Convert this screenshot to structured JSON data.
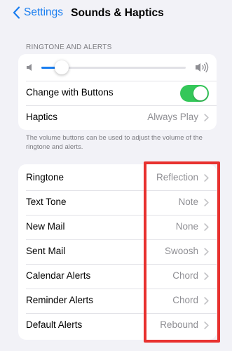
{
  "nav": {
    "back_label": "Settings",
    "title": "Sounds & Haptics"
  },
  "ringtone_alerts": {
    "header": "RINGTONE AND ALERTS",
    "volume_level_percent": 10,
    "change_with_buttons": {
      "label": "Change with Buttons",
      "enabled": true
    },
    "haptics": {
      "label": "Haptics",
      "value": "Always Play"
    },
    "footer": "The volume buttons can be used to adjust the volume of the ringtone and alerts."
  },
  "sounds": {
    "rows": [
      {
        "label": "Ringtone",
        "value": "Reflection"
      },
      {
        "label": "Text Tone",
        "value": "Note"
      },
      {
        "label": "New Mail",
        "value": "None"
      },
      {
        "label": "Sent Mail",
        "value": "Swoosh"
      },
      {
        "label": "Calendar Alerts",
        "value": "Chord"
      },
      {
        "label": "Reminder Alerts",
        "value": "Chord"
      },
      {
        "label": "Default Alerts",
        "value": "Rebound"
      }
    ]
  },
  "colors": {
    "accent": "#1a7ef0",
    "toggle_on": "#34c759",
    "highlight": "#e8312f",
    "background": "#f2f2f7"
  },
  "icons": [
    "chevron-left-icon",
    "speaker-low-icon",
    "speaker-high-icon",
    "chevron-right-icon"
  ]
}
